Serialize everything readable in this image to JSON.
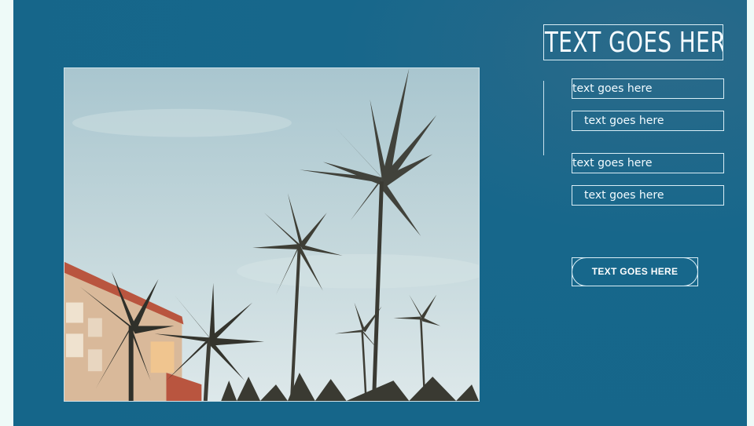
{
  "slide": {
    "title": "TEXT GOES HERE",
    "fields": [
      "text goes here",
      "text goes here",
      "text goes here",
      "text goes here"
    ],
    "cta_label": "TEXT GOES HERE"
  },
  "colors": {
    "background": "#15668a",
    "outline": "#d9eef6",
    "canvas": "#eefaf8"
  },
  "image": {
    "subject": "palm-trees-photo"
  }
}
